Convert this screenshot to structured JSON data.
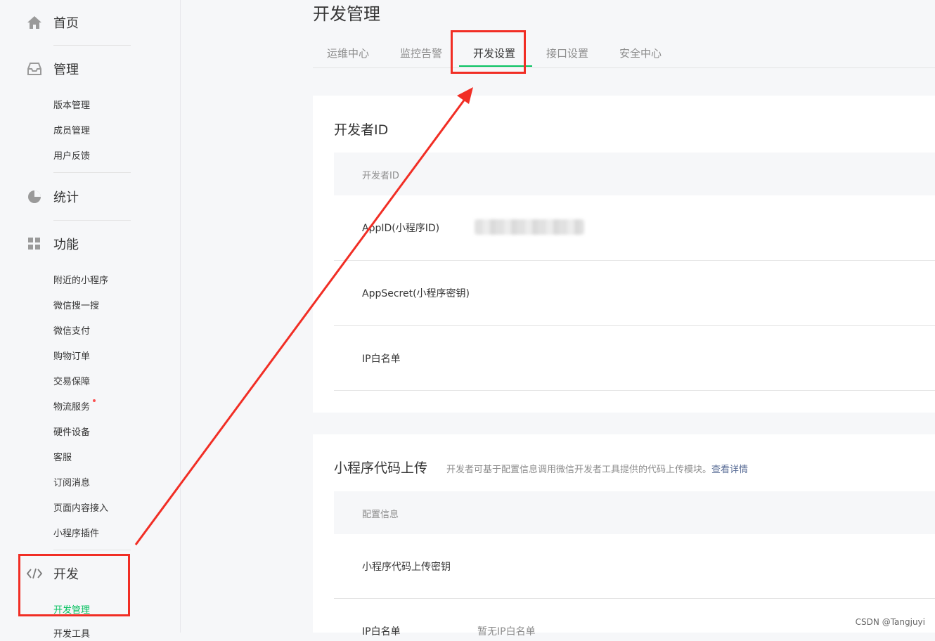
{
  "sidebar": {
    "groups": [
      {
        "label": "首页",
        "icon": "home-icon"
      },
      {
        "label": "管理",
        "icon": "inbox-icon",
        "items": [
          "版本管理",
          "成员管理",
          "用户反馈"
        ]
      },
      {
        "label": "统计",
        "icon": "pie-chart-icon"
      },
      {
        "label": "功能",
        "icon": "grid-icon",
        "items": [
          "附近的小程序",
          "微信搜一搜",
          "微信支付",
          "购物订单",
          "交易保障",
          "物流服务",
          "硬件设备",
          "客服",
          "订阅消息",
          "页面内容接入",
          "小程序插件"
        ]
      },
      {
        "label": "开发",
        "icon": "code-icon",
        "items": [
          "开发管理",
          "开发工具"
        ]
      }
    ]
  },
  "page": {
    "title": "开发管理"
  },
  "tabs": [
    {
      "label": "运维中心"
    },
    {
      "label": "监控告警"
    },
    {
      "label": "开发设置",
      "active": true
    },
    {
      "label": "接口设置"
    },
    {
      "label": "安全中心"
    }
  ],
  "developer_id_card": {
    "title": "开发者ID",
    "header": "开发者ID",
    "rows": [
      {
        "label": "AppID(小程序ID)"
      },
      {
        "label": "AppSecret(小程序密钥)"
      },
      {
        "label": "IP白名单"
      }
    ]
  },
  "upload_card": {
    "title": "小程序代码上传",
    "desc": "开发者可基于配置信息调用微信开发者工具提供的代码上传模块。",
    "link": "查看详情",
    "header": "配置信息",
    "rows": [
      {
        "label": "小程序代码上传密钥",
        "value": ""
      },
      {
        "label": "IP白名单",
        "value": "暂无IP白名单"
      }
    ]
  },
  "colors": {
    "accent": "#07c160",
    "annotation": "#f12e25",
    "link": "#576b95"
  },
  "watermark": "CSDN @Tangjuyi"
}
